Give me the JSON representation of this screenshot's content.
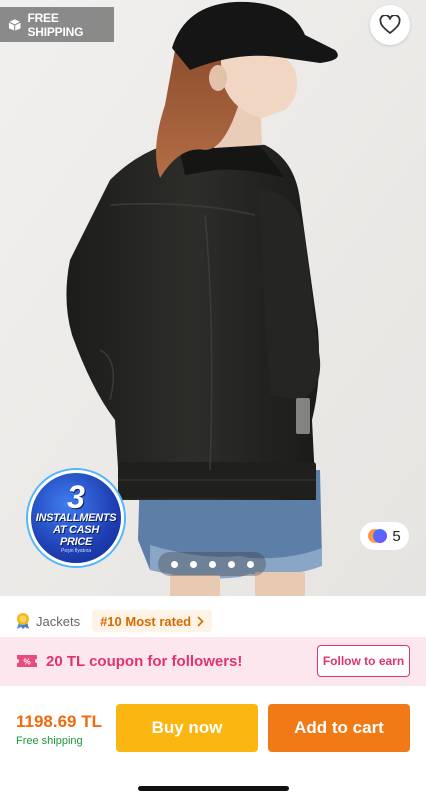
{
  "badge": {
    "free_shipping": "FREE SHIPPING"
  },
  "icons": {
    "favorite": "heart-icon",
    "shipping": "box-icon",
    "category": "medal-icon",
    "coupon": "coupon-icon",
    "chevron": "chevron-right-icon"
  },
  "promo": {
    "number": "3",
    "line1": "INSTALLMENTS",
    "line2": "AT CASH",
    "line3": "PRICE",
    "small": "Peşin fiyatına"
  },
  "gallery": {
    "color_count": "5",
    "page_count": 5,
    "active_page": 4
  },
  "category": {
    "name": "Jackets",
    "rank": "#10 Most rated"
  },
  "coupon": {
    "text": "20 TL coupon for followers!",
    "follow_label": "Follow to earn"
  },
  "purchase": {
    "price": "1198.69 TL",
    "shipping_note": "Free shipping",
    "buy_label": "Buy now",
    "cart_label": "Add to cart"
  },
  "colors": {
    "accent_orange": "#f06a0f",
    "buy_yellow": "#fbb612",
    "cart_orange": "#f07a16",
    "coupon_pink": "#e0336e",
    "coupon_bg": "#fde7ef",
    "free_green": "#1a9a3a"
  }
}
